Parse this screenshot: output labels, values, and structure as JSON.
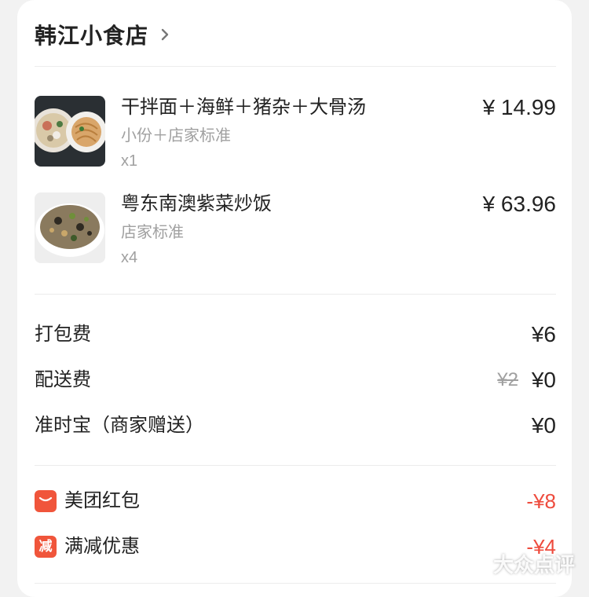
{
  "store": {
    "name": "韩江小食店",
    "icon": "chevron-right-icon"
  },
  "items": [
    {
      "name": "干拌面＋海鲜＋猪杂＋大骨汤",
      "spec": "小份＋店家标准",
      "qty": "x1",
      "price": "¥ 14.99",
      "thumb": "noodle-soup-photo"
    },
    {
      "name": "粤东南澳紫菜炒饭",
      "spec": "店家标准",
      "qty": "x4",
      "price": "¥ 63.96",
      "thumb": "fried-rice-photo"
    }
  ],
  "fees": {
    "packing": {
      "label": "打包费",
      "value": "¥6"
    },
    "delivery": {
      "label": "配送费",
      "old_value": "¥2",
      "value": "¥0"
    },
    "ontime": {
      "label": "准时宝（商家赠送）",
      "value": "¥0"
    }
  },
  "promotions": [
    {
      "label": "美团红包",
      "value": "-¥8",
      "icon": "red-envelope-icon",
      "icon_text": ""
    },
    {
      "label": "满减优惠",
      "value": "-¥4",
      "icon": "discount-badge-icon",
      "icon_text": "减"
    }
  ],
  "colors": {
    "promo_red": "#f0553b",
    "promo_value": "#ee4b3d",
    "text_primary": "#222222",
    "text_secondary": "#a0a0a0"
  },
  "watermark": {
    "text": "大众点评",
    "icon": "dianping-logo-icon"
  }
}
